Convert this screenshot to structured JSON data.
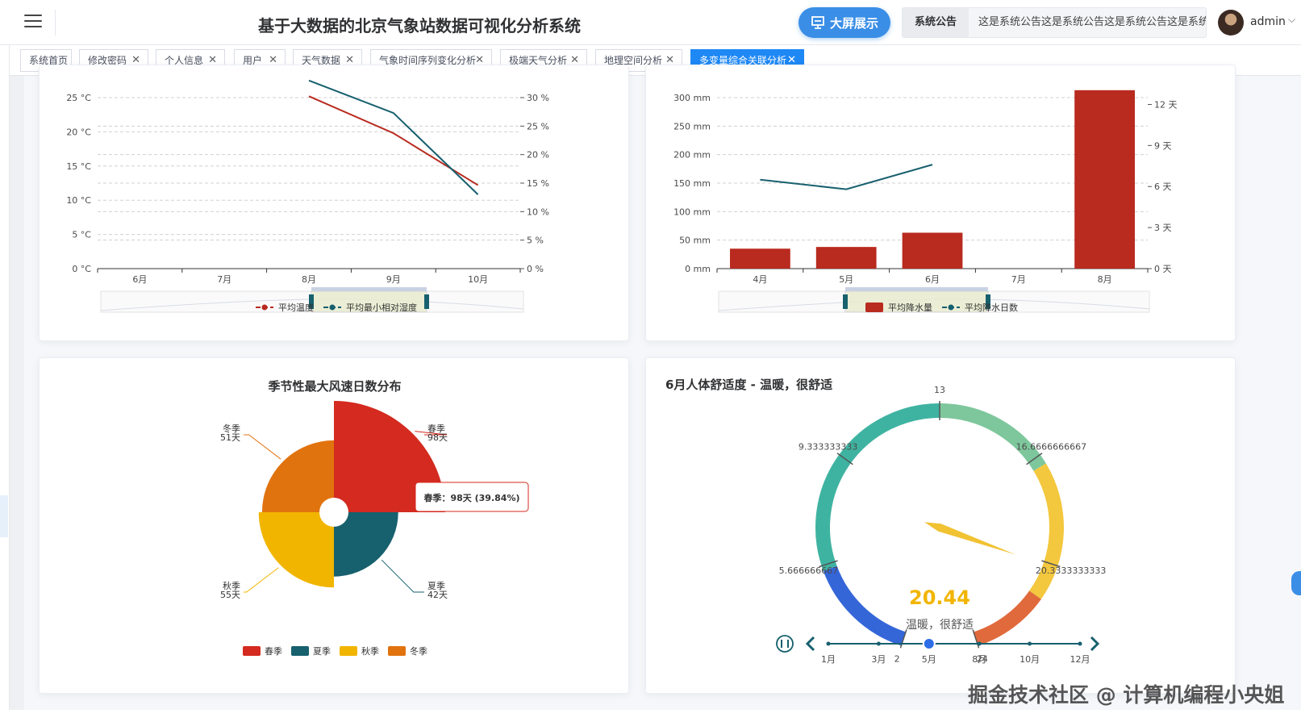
{
  "header": {
    "title": "基于大数据的北京气象站数据可视化分析系统",
    "screen_button": "大屏展示",
    "notice_label": "系统公告",
    "notice_text": "这是系统公告这是系统公告这是系统公告这是系统",
    "username": "admin"
  },
  "tabs": [
    {
      "label": "系统首页",
      "closable": false
    },
    {
      "label": "修改密码",
      "closable": true
    },
    {
      "label": "个人信息",
      "closable": true
    },
    {
      "label": "用户",
      "closable": true
    },
    {
      "label": "天气数据",
      "closable": true
    },
    {
      "label": "气象时间序列变化分析",
      "closable": true
    },
    {
      "label": "极端天气分析",
      "closable": true
    },
    {
      "label": "地理空间分析",
      "closable": true
    },
    {
      "label": "多变量综合关联分析",
      "closable": true,
      "active": true
    }
  ],
  "colors": {
    "red": "#b92a1f",
    "teal": "#17606e",
    "yellow": "#f1b500",
    "orange": "#e1730f",
    "accent": "#1e88f5"
  },
  "chart_data": [
    {
      "type": "line",
      "categories": [
        "6月",
        "7月",
        "8月",
        "9月",
        "10月"
      ],
      "y_left": {
        "ticks": [
          "0 °C",
          "5 °C",
          "10 °C",
          "15 °C",
          "20 °C",
          "25 °C"
        ],
        "range": [
          0,
          25
        ]
      },
      "y_right": {
        "ticks": [
          "0 %",
          "5 %",
          "10 %",
          "15 %",
          "20 %",
          "25 %",
          "30 %"
        ],
        "range": [
          0,
          30
        ]
      },
      "series": [
        {
          "name": "平均温度",
          "axis": "left",
          "color": "#b92a1f",
          "values": [
            null,
            null,
            25.2,
            19.8,
            12.2
          ]
        },
        {
          "name": "平均最小相对湿度",
          "axis": "right",
          "color": "#17606e",
          "values": [
            null,
            null,
            33,
            27.3,
            13
          ]
        }
      ],
      "grid": true,
      "legend": "bottom"
    },
    {
      "type": "bar",
      "categories": [
        "4月",
        "5月",
        "6月",
        "7月",
        "8月"
      ],
      "y_left": {
        "ticks": [
          "0 mm",
          "50 mm",
          "100 mm",
          "150 mm",
          "200 mm",
          "250 mm",
          "300 mm"
        ],
        "range": [
          0,
          300
        ]
      },
      "y_right": {
        "ticks": [
          "0 天",
          "3 天",
          "6 天",
          "9 天",
          "12 天"
        ],
        "range": [
          0,
          12.5
        ]
      },
      "series": [
        {
          "name": "平均降水量",
          "type": "bar",
          "axis": "left",
          "color": "#b92a1f",
          "values": [
            35,
            38,
            63,
            null,
            313
          ]
        },
        {
          "name": "平均降水日数",
          "type": "line",
          "axis": "right",
          "color": "#17606e",
          "values": [
            6.5,
            5.8,
            7.6,
            null,
            null
          ]
        }
      ],
      "grid": true,
      "legend": "bottom"
    },
    {
      "type": "pie",
      "title": "季节性最大风速日数分布",
      "slices": [
        {
          "name": "春季",
          "value": 98,
          "unit": "天",
          "color": "#d42a1f",
          "label": "春季\n98天"
        },
        {
          "name": "夏季",
          "value": 42,
          "unit": "天",
          "color": "#17606e",
          "label": "夏季\n42天"
        },
        {
          "name": "秋季",
          "value": 55,
          "unit": "天",
          "color": "#f1b500",
          "label": "秋季\n55天"
        },
        {
          "name": "冬季",
          "value": 51,
          "unit": "天",
          "color": "#e1730f",
          "label": "冬季\n51天"
        }
      ],
      "tooltip": "春季：98天 (39.84%)",
      "legend": "bottom"
    },
    {
      "type": "gauge",
      "title": "6月人体舒适度 - 温暖，很舒适",
      "min": 2,
      "max": 24,
      "tick_labels": [
        "2",
        "5.666666667",
        "9.333333333",
        "13",
        "16.6666666667",
        "20.3333333333",
        "24"
      ],
      "value": 20.44,
      "value_label": "20.44",
      "status": "温暖，很舒适",
      "timeline": {
        "months": [
          "1月",
          "3月",
          "5月",
          "8月",
          "10月",
          "12月"
        ],
        "current": "5月"
      }
    }
  ],
  "watermark": "掘金技术社区 @ 计算机编程小央姐"
}
